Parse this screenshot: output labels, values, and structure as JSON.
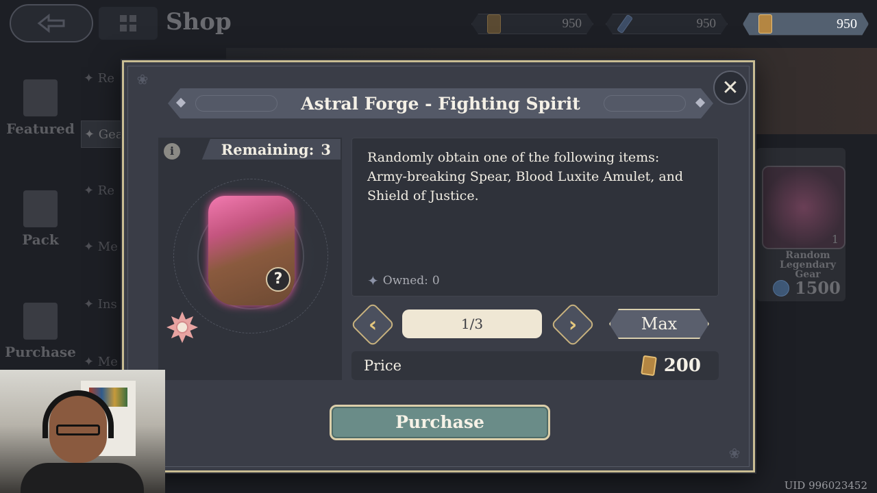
{
  "header": {
    "title": "Shop",
    "currencies": [
      {
        "icon": "ticket-icon",
        "amount": "950",
        "active": false
      },
      {
        "icon": "sword-icon",
        "amount": "950",
        "active": false
      },
      {
        "icon": "ticket-icon",
        "amount": "950",
        "active": true
      }
    ]
  },
  "left_nav": {
    "items": [
      {
        "label": "Featured",
        "icon": "star-icon"
      },
      {
        "label": "Pack",
        "icon": "gift-icon"
      },
      {
        "label": "Purchase",
        "icon": "star-outline-icon"
      }
    ],
    "sub_items": [
      "✦ Re",
      "✦ Gea",
      "✦ Re",
      "✦ Me",
      "✦ Ins",
      "✦ Me"
    ]
  },
  "background_card": {
    "name_line1": "Random Legendary",
    "name_line2": "Gear",
    "count": "1",
    "price": "1500"
  },
  "modal": {
    "title": "Astral Forge - Fighting Spirit",
    "remaining_label": "Remaining:",
    "remaining_value": "3",
    "description": "Randomly obtain one of the following items: Army-breaking Spear, Blood Luxite Amulet, and Shield of Justice.",
    "owned_label": "Owned:",
    "owned_value": "0",
    "quantity": "1/3",
    "max_label": "Max",
    "price_label": "Price",
    "price_value": "200",
    "purchase_label": "Purchase",
    "info_glyph": "i",
    "close_glyph": "✕",
    "qmark": "?"
  },
  "footer": {
    "uid": "UID 996023452"
  },
  "colors": {
    "accent_gold": "#c9bd93",
    "purchase_green": "#6a8c88",
    "modal_bg": "#3a3d47"
  }
}
